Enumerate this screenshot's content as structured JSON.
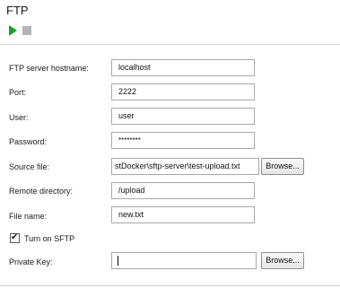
{
  "title": "FTP",
  "toolbar": {
    "run_icon": "play-icon",
    "stop_icon": "stop-icon"
  },
  "form": {
    "hostname": {
      "label": "FTP server hostname:",
      "value": "localhost"
    },
    "port": {
      "label": "Port:",
      "value": "2222"
    },
    "user": {
      "label": "User:",
      "value": "user"
    },
    "password": {
      "label": "Password:",
      "value": "********"
    },
    "source_file": {
      "label": "Source file:",
      "value": "stDocker\\sftp-server\\test-upload.txt",
      "browse": "Browse..."
    },
    "remote_directory": {
      "label": "Remote directory:",
      "value": "/upload"
    },
    "file_name": {
      "label": "File name:",
      "value": "new.txt"
    },
    "sftp": {
      "label": "Turn on SFTP",
      "checked": true
    },
    "private_key": {
      "label": "Private Key:",
      "value": "",
      "browse": "Browse..."
    }
  }
}
